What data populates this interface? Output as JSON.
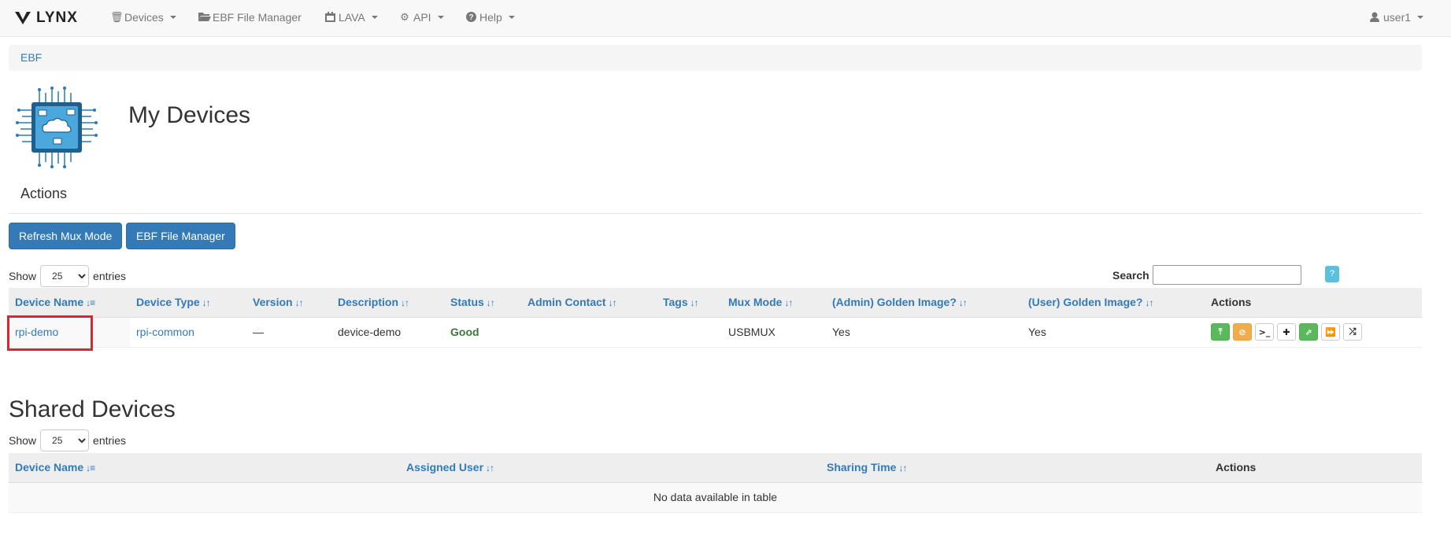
{
  "navbar": {
    "brand": "LYNX",
    "items": [
      {
        "label": "Devices",
        "icon": "trash-icon"
      },
      {
        "label": "EBF File Manager",
        "icon": "folder-open-icon"
      },
      {
        "label": "LAVA",
        "icon": "calendar-icon"
      },
      {
        "label": "API",
        "icon": "gear-icon"
      },
      {
        "label": "Help",
        "icon": "question-circle-icon"
      }
    ],
    "user": "user1"
  },
  "breadcrumb": {
    "item": "EBF"
  },
  "page": {
    "title": "My Devices",
    "actions_heading": "Actions",
    "buttons": {
      "refresh": "Refresh Mux Mode",
      "ebf": "EBF File Manager"
    }
  },
  "my_devices": {
    "length": {
      "show": "Show",
      "value": "25",
      "entries": "entries"
    },
    "search_label": "Search",
    "help_label": "?",
    "columns": [
      "Device Name",
      "Device Type",
      "Version",
      "Description",
      "Status",
      "Admin Contact",
      "Tags",
      "Mux Mode",
      "(Admin) Golden Image?",
      "(User) Golden Image?",
      "Actions"
    ],
    "rows": [
      {
        "device_name": "rpi-demo",
        "device_type": "rpi-common",
        "version": "—",
        "description": "device-demo",
        "status": "Good",
        "admin_contact": "",
        "tags": "",
        "mux_mode": "USBMUX",
        "admin_golden": "Yes",
        "user_golden": "Yes"
      }
    ],
    "action_icons": [
      "upload-icon",
      "ban-icon",
      "terminal-icon",
      "plus-icon",
      "share-icon",
      "fast-forward-icon",
      "random-icon"
    ]
  },
  "shared_devices": {
    "title": "Shared Devices",
    "length": {
      "show": "Show",
      "value": "25",
      "entries": "entries"
    },
    "columns": [
      "Device Name",
      "Assigned User",
      "Sharing Time",
      "Actions"
    ],
    "empty_text": "No data available in table"
  }
}
